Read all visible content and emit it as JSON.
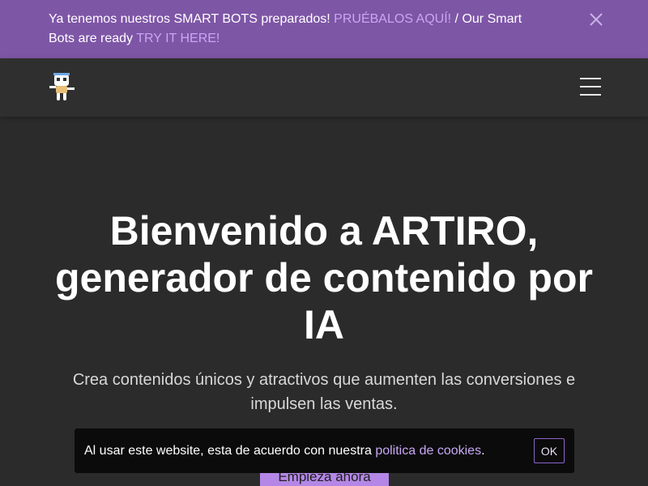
{
  "banner": {
    "text_before": "Ya tenemos nuestros SMART BOTS preparados! ",
    "link_es": "PRUÉBALOS AQUÍ!",
    "text_middle": " / Our Smart Bots are ready ",
    "link_en": "TRY IT HERE!",
    "close_icon": "close-icon"
  },
  "navbar": {
    "logo_icon": "robot-logo-icon",
    "menu_icon": "hamburger-menu-icon"
  },
  "hero": {
    "title": "Bienvenido a ARTIRO, generador de contenido por IA",
    "subtitle": "Crea contenidos únicos y atractivos que aumenten las conversiones e impulsen las ventas.",
    "cta_label": "Empieza ahora"
  },
  "cookie": {
    "text_before": "Al usar este website, esta de acuerdo con nuestra ",
    "link": "politica de cookies",
    "text_after": ".",
    "ok_label": "OK"
  },
  "colors": {
    "banner_bg": "#7e56a6",
    "accent_link": "#c8a7f5",
    "page_bg": "#2b2b2b",
    "cta_bg": "#b487e6",
    "cookie_bg": "#0b0b0b"
  }
}
